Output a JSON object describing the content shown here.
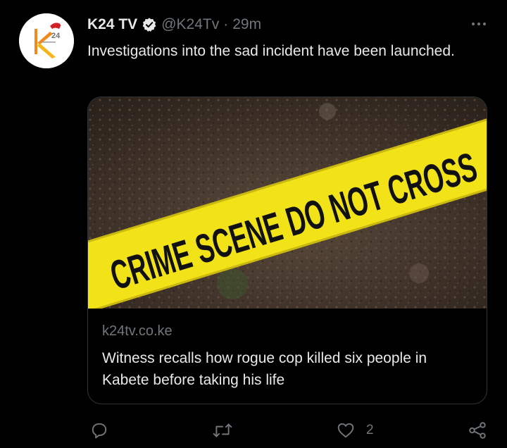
{
  "tweet": {
    "author": {
      "display_name": "K24 TV",
      "handle": "@K24Tv",
      "verified": true,
      "avatar_icon": "k24-logo-icon",
      "avatar_logo_text": "24"
    },
    "separator": "·",
    "time": "29m",
    "text": "Investigations into the sad incident have been launched.",
    "card": {
      "image_caption": "CRIME SCENE DO NOT CROSS",
      "domain": "k24tv.co.ke",
      "title": "Witness recalls how rogue cop killed six people in Kabete before taking his life"
    },
    "actions": {
      "reply": {
        "icon": "reply-icon",
        "count": ""
      },
      "retweet": {
        "icon": "retweet-icon",
        "count": ""
      },
      "like": {
        "icon": "heart-icon",
        "count": "2"
      },
      "share": {
        "icon": "share-icon",
        "count": ""
      }
    }
  },
  "colors": {
    "background": "#000000",
    "primary_text": "#e7e9ea",
    "secondary_text": "#71767b",
    "border": "#2f3336",
    "tape_yellow": "#f2e218",
    "logo_orange": "#f08a1c"
  }
}
